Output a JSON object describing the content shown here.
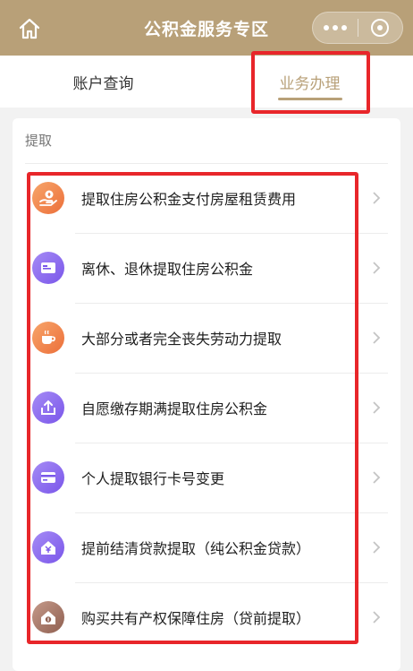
{
  "header": {
    "title": "公积金服务专区",
    "background_color": "#b8a078",
    "home_icon": "home-icon",
    "more_icon": "more-dots-icon",
    "close_icon": "target-circle-icon"
  },
  "tabs": [
    {
      "label": "账户查询",
      "active": false
    },
    {
      "label": "业务办理",
      "active": true
    }
  ],
  "section": {
    "title": "提取",
    "items": [
      {
        "label": "提取住房公积金支付房屋租赁费用",
        "icon": "money-hand-icon",
        "color": "#f08a4b"
      },
      {
        "label": "离休、退休提取住房公积金",
        "icon": "id-card-icon",
        "color": "#8c6cf0"
      },
      {
        "label": "大部分或者完全丧失劳动力提取",
        "icon": "coffee-cup-icon",
        "color": "#f08a4b"
      },
      {
        "label": "自愿缴存期满提取住房公积金",
        "icon": "upload-tray-icon",
        "color": "#8c6cf0"
      },
      {
        "label": "个人提取银行卡号变更",
        "icon": "bank-card-icon",
        "color": "#8c6cf0"
      },
      {
        "label": "提前结清贷款提取（纯公积金贷款）",
        "icon": "yuan-house-icon",
        "color": "#8c6cf0"
      },
      {
        "label": "购买共有产权保障住房（贷前提取）",
        "icon": "house-dollar-icon",
        "color": "#a87a68"
      }
    ]
  },
  "highlight_color": "#e8262a",
  "accent_color": "#b8a078"
}
